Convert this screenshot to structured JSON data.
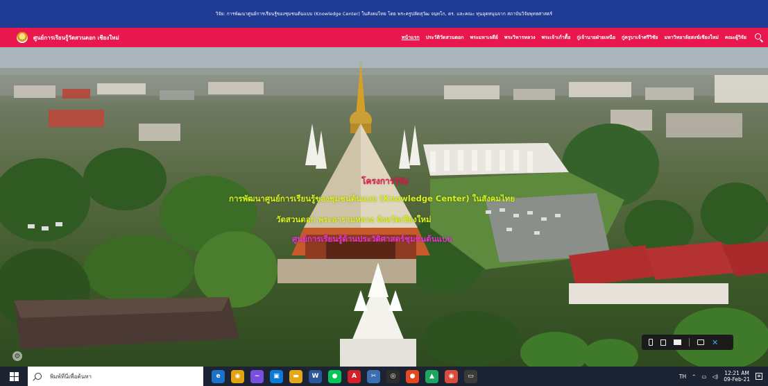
{
  "topbar": {
    "text": "วิจัย: การพัฒนาศูนย์การเรียนรู้ของชุมชนต้นแบบ (Knowledge Center) ในสังคมไทย โดย พระครูปลัดสุวัฒ จนฺทโก, ดร. และคณะ ทุนอุดหนุนจาก สถาบันวิจัยพุทธศาสตร์"
  },
  "navbar": {
    "site_title": "ศูนย์การเรียนรู้วัดสวนดอก เชียงใหม่",
    "items": [
      "หน้าแรก",
      "ประวัติวัดสวนดอก",
      "พระมหาเจดีย์",
      "พระวิหารหลวง",
      "พระเจ้าเก้าตื้อ",
      "กู่เจ้านายฝ่ายเหนือ",
      "กู่ครูบาเจ้าศรีวิชัย",
      "มหาวิทยาลัยสงฆ์เชียงใหม่",
      "คณะผู้วิจัย"
    ],
    "accent_color": "#e8174e"
  },
  "hero": {
    "line1": "โครงการวิจัย",
    "line2": "การพัฒนาศูนย์การเรียนรู้ของชุมชนต้นแบบ (Knowledge Center) ในสังคมไทย",
    "line3": "วัดสวนดอก พระอารามหลวง จังหวัดเชียงใหม่",
    "line4": "ศูนย์การเรียนรู้ด้านประวัติศาสตร์ชุมชนต้นแบบ"
  },
  "taskbar": {
    "search_placeholder": "พิมพ์ที่นี่เพื่อค้นหา",
    "apps": [
      {
        "name": "edge-icon",
        "glyph": "e",
        "color": "#1a73c9"
      },
      {
        "name": "chrome-icon",
        "glyph": "◉",
        "color": "#e1a40d"
      },
      {
        "name": "messenger-icon",
        "glyph": "~",
        "color": "#7a4fe0"
      },
      {
        "name": "store-icon",
        "glyph": "▣",
        "color": "#0a7bd5"
      },
      {
        "name": "file-explorer-icon",
        "glyph": "▬",
        "color": "#e6a817"
      },
      {
        "name": "word-icon",
        "glyph": "W",
        "color": "#2b579a"
      },
      {
        "name": "line-icon",
        "glyph": "●",
        "color": "#06c755"
      },
      {
        "name": "acrobat-icon",
        "glyph": "A",
        "color": "#d32027"
      },
      {
        "name": "snip-icon",
        "glyph": "✂",
        "color": "#3a6fb2"
      },
      {
        "name": "app-circle-icon",
        "glyph": "◎",
        "color": "#2d2d2d"
      },
      {
        "name": "paint-icon",
        "glyph": "●",
        "color": "#e5471f"
      },
      {
        "name": "drive-icon",
        "glyph": "▲",
        "color": "#1fa463"
      },
      {
        "name": "chrome2-icon",
        "glyph": "◉",
        "color": "#d94b3a"
      },
      {
        "name": "photos-icon",
        "glyph": "▭",
        "color": "#3a3a3a"
      }
    ],
    "lang": "TH",
    "time": "12:21 AM",
    "date": "09-Feb-21"
  }
}
